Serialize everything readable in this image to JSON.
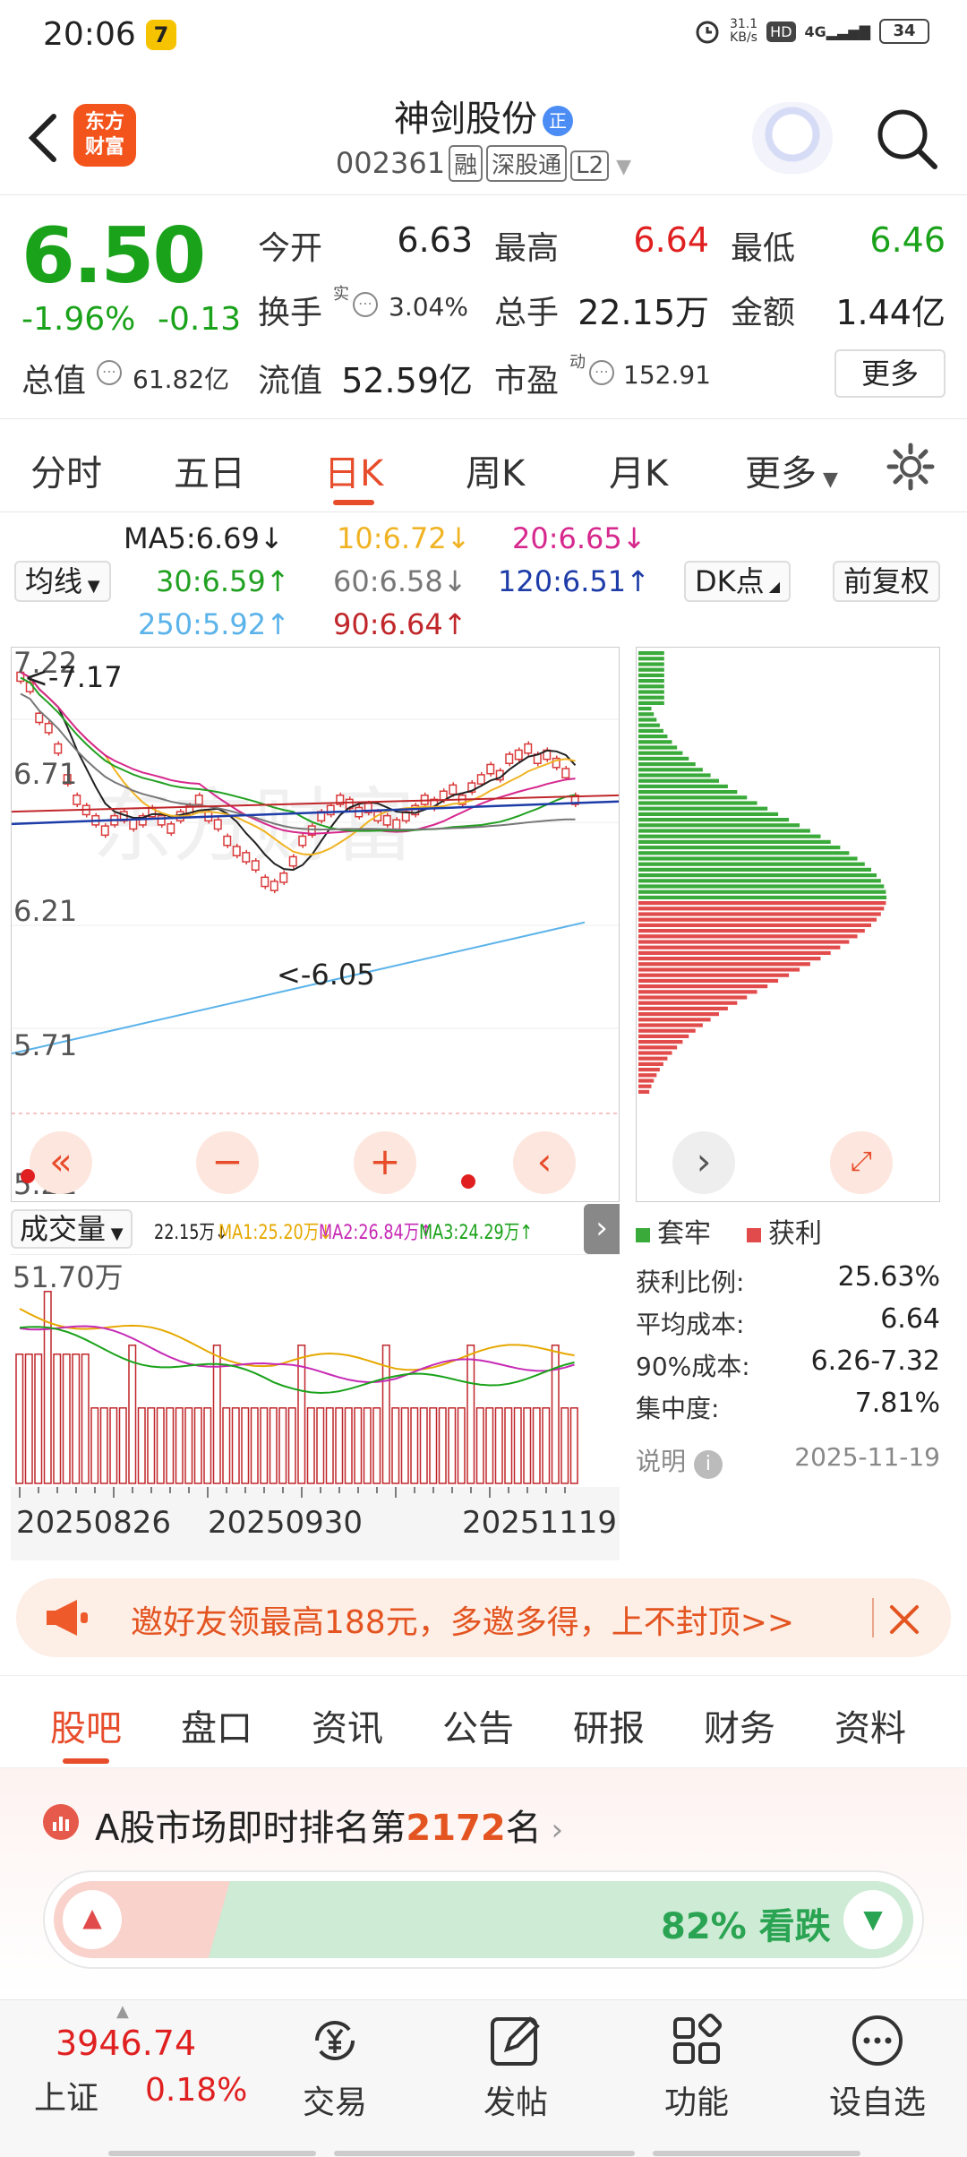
{
  "status_bar": {
    "time": "20:06",
    "net_speed": "31.1\nKB/s",
    "hd": "HD",
    "signal": "4G",
    "battery": "34"
  },
  "header": {
    "logo": "东方\n财富",
    "title": "神剑股份",
    "title_badge": "正",
    "code": "002361",
    "tags": [
      "融",
      "深股通",
      "L2"
    ]
  },
  "quote": {
    "price": "6.50",
    "change_pct": "-1.96%",
    "change": "-0.13",
    "open_label": "今开",
    "open": "6.63",
    "high_label": "最高",
    "high": "6.64",
    "low_label": "最低",
    "low": "6.46",
    "turnover_label": "换手",
    "turnover_sup": "实",
    "turnover": "3.04%",
    "volume_label": "总手",
    "volume": "22.15万",
    "amount_label": "金额",
    "amount": "1.44亿",
    "mktcap_label": "总值",
    "mktcap": "61.82亿",
    "float_label": "流值",
    "float": "52.59亿",
    "pe_label": "市盈",
    "pe_sup": "动",
    "pe": "152.91",
    "more": "更多"
  },
  "tabs": [
    "分时",
    "五日",
    "日K",
    "周K",
    "月K",
    "更多"
  ],
  "ma": {
    "ma5": "MA5:6.69",
    "ma10": "10:6.72",
    "ma20": "20:6.65",
    "ma30": "30:6.59",
    "ma60": "60:6.58",
    "ma120": "120:6.51",
    "ma250": "250:5.92",
    "ma90": "90:6.64",
    "arrow_down": "↓",
    "arrow_up": "↑",
    "line_btn": "均线",
    "dk_btn": "DK点",
    "adj_btn": "前复权",
    "colors": {
      "ma5": "#222222",
      "ma10": "#f0b323",
      "ma20": "#d6288d",
      "ma30": "#22a022",
      "ma60": "#777777",
      "ma120": "#1d3ca8",
      "ma250": "#5bb3ea",
      "ma90": "#c0262a"
    }
  },
  "kchart": {
    "y_labels": [
      "7.22",
      "6.71",
      "6.21",
      "5.71",
      "5.21"
    ],
    "high_mark": "<-7.17",
    "low_mark": "<-6.05",
    "watermark": "东方财富"
  },
  "volume": {
    "label": "成交量",
    "cur": "22.15万↓",
    "ma1": "MA1:25.20万↓",
    "ma2": "MA2:26.84万↑",
    "ma3": "MA3:24.29万↑",
    "y_top": "51.70万"
  },
  "dates": [
    "20250826",
    "20250930",
    "20251119"
  ],
  "chips": {
    "legend_trap": "套牢",
    "legend_profit": "获利",
    "rows": [
      [
        "获利比例:",
        "25.63%"
      ],
      [
        "平均成本:",
        "6.64"
      ],
      [
        "90%成本:",
        "6.26-7.32"
      ],
      [
        "集中度:",
        "7.81%"
      ]
    ],
    "note": "说明",
    "date": "2025-11-19"
  },
  "banner": {
    "text": "邀好友领最高188元，多邀多得，上不封顶>>"
  },
  "sub_tabs": [
    "股吧",
    "盘口",
    "资讯",
    "公告",
    "研报",
    "财务",
    "资料"
  ],
  "rank": {
    "prefix": "A股市场即时排名第",
    "num": "2172",
    "suffix": "名",
    "bear_text": "82% 看跌",
    "bear_pct": 82
  },
  "footer": {
    "index_value": "3946.74",
    "index_name": "上证",
    "index_pct": "0.18%",
    "items": [
      "交易",
      "发帖",
      "功能",
      "设自选"
    ]
  }
}
